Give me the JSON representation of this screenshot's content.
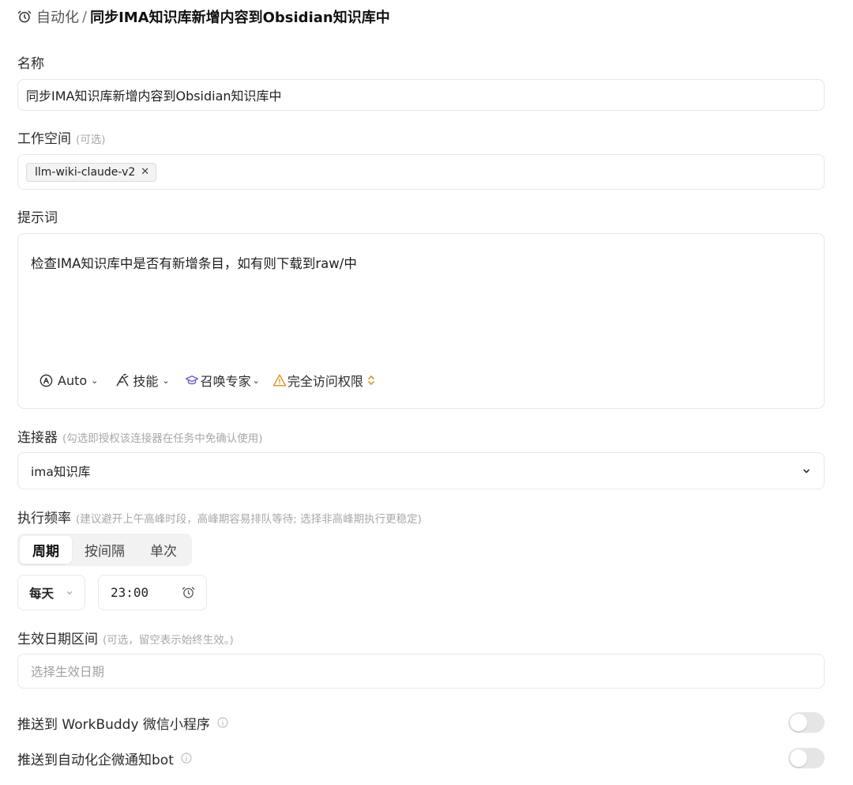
{
  "breadcrumb": {
    "parent": "自动化",
    "separator": "/",
    "title": "同步IMA知识库新增内容到Obsidian知识库中",
    "icon": "alarm-clock-icon"
  },
  "name": {
    "label": "名称",
    "value": "同步IMA知识库新增内容到Obsidian知识库中"
  },
  "workspace": {
    "label": "工作空间",
    "hint": "(可选)",
    "chips": [
      {
        "label": "llm-wiki-claude-v2",
        "remove": "✕"
      }
    ]
  },
  "prompt": {
    "label": "提示词",
    "value": "检查IMA知识库中是否有新增条目，如有则下载到raw/中",
    "toolbar": {
      "model": "Auto",
      "skills": "技能",
      "expert": "召唤专家",
      "permission": "完全访问权限"
    }
  },
  "connector": {
    "label": "连接器",
    "hint": "(勾选即授权该连接器在任务中免确认使用)",
    "value": "ima知识库"
  },
  "frequency": {
    "label": "执行频率",
    "hint": "(建议避开上午高峰时段，高峰期容易排队等待; 选择非高峰期执行更稳定)",
    "tabs": [
      {
        "label": "周期",
        "active": true
      },
      {
        "label": "按间隔",
        "active": false
      },
      {
        "label": "单次",
        "active": false
      }
    ],
    "period": "每天",
    "time": "23:00"
  },
  "date_range": {
    "label": "生效日期区间",
    "hint": "(可选，留空表示始终生效。)",
    "placeholder": "选择生效日期"
  },
  "push_workbuddy": {
    "label": "推送到 WorkBuddy 微信小程序",
    "enabled": false
  },
  "push_bot": {
    "label": "推送到自动化企微通知bot",
    "enabled": false
  },
  "colors": {
    "expert_icon": "#6b5bd6",
    "warning_icon": "#e0952a",
    "toggle_off": "#e6e6e6",
    "border": "#e8e8e8",
    "hint": "#a8a8a8"
  }
}
